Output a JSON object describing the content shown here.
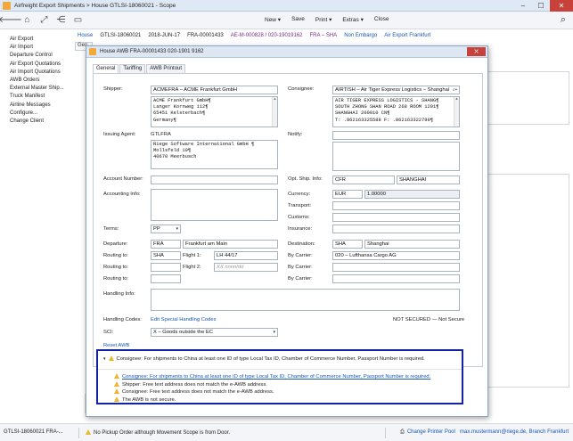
{
  "window": {
    "title": "Airfreight Export Shipments > House GTLSI-18060021 - Scope",
    "controls": {
      "minimize": "–",
      "maximize": "☐",
      "close": "✕"
    }
  },
  "toolbar": {
    "menu": {
      "new": "New ▾",
      "save": "Save",
      "print": "Print ▾",
      "extras": "Extras ▾",
      "close": "Close"
    },
    "icons": [
      "back-arrow-icon",
      "home-icon",
      "expand-icon",
      "share-icon",
      "inbox-icon",
      "search-icon"
    ]
  },
  "left_nav": {
    "items": [
      "Air Export",
      "Air Import",
      "Departure Control",
      "Air Export Quotations",
      "Air Import Quotations",
      "AWB Orders",
      "External Master Ship...",
      "Truck Manifest",
      "Airline Messages",
      "Configure...",
      "Change Client"
    ]
  },
  "main_header": {
    "house": "House",
    "ref1": "GTLSI-18060021",
    "date": "2018-JUN-17",
    "fra": "FRA-00001433",
    "awb": "AE-M-000828 / 020-19019162",
    "route": "FRA – SHA",
    "embargo": "Non Embargo",
    "station": "Air Export Frankfurt",
    "bg_tab": "Gen"
  },
  "dialog": {
    "title": "House AWB FRA-00001433 020-1901 9162",
    "close": "✕",
    "tabs": [
      "General",
      "Tariffing",
      "AWB Printout"
    ],
    "shipper": {
      "label": "Shipper:",
      "value": "ACMEFRA – ACME Frankfurt GmbH",
      "lines": [
        "ACME Frankfurt GmbH¶",
        "Langer Kornweg 112¶",
        "65451 Kelsterbach¶",
        "Germany¶"
      ]
    },
    "consignee": {
      "label": "Consignee:",
      "value": "AIRTISH – Air Tiger Express Logistics – Shanghai",
      "lines": [
        "AIR TIGER EXPRESS LOGISTICS - SHANG¶",
        "SOUTH ZHONG SHAN ROAD 268 ROOM 1201¶",
        "SHANGHAI 200010 CN¶",
        "T: .862163325588 F: .862163322799¶"
      ]
    },
    "issuing_agent": {
      "label": "Issuing Agent:",
      "value": "GTLFRA",
      "lines": [
        "Riege Software International GmbH ¶",
        "Mollsfeld 10¶",
        "40670 Meerbusch"
      ]
    },
    "notify": {
      "label": "Notify:"
    },
    "account_number": {
      "label": "Account Number:"
    },
    "opt_ship_info": {
      "label": "Opt. Ship. Info:",
      "code": "CFR",
      "city": "SHANGHAI"
    },
    "accounting_info": {
      "label": "Accounting Info:"
    },
    "currency": {
      "label": "Currency:",
      "code": "EUR",
      "rate": "1.00000"
    },
    "transport": {
      "label": "Transport:"
    },
    "customs": {
      "label": "Customs:"
    },
    "insurance": {
      "label": "Insurance:"
    },
    "terms": {
      "label": "Terms:",
      "value": "PP"
    },
    "departure": {
      "label": "Departure:",
      "code": "FRA",
      "name": "Frankfurt am Main"
    },
    "destination": {
      "label": "Destination:",
      "code": "SHA",
      "name": "Shanghai"
    },
    "routing1": {
      "label": "Routing to:",
      "value": "SHA",
      "flight_label": "Flight 1:",
      "flight": "LH 44/17"
    },
    "by_carrier1": {
      "label": "By Carrier:",
      "value": "020 – Lufthansa Cargo AG"
    },
    "routing2": {
      "label": "Routing to:",
      "flight_label": "Flight 2:",
      "flight_placeholder": "XX nnnn/dd"
    },
    "by_carrier2": {
      "label": "By Carrier:"
    },
    "routing3": {
      "label": "Routing to:"
    },
    "by_carrier3": {
      "label": "By Carrier:"
    },
    "handling_info": {
      "label": "Handling Info:"
    },
    "handling_codes": {
      "label": "Handling Codes:",
      "link": "Edit Special Handling Codes"
    },
    "security": "NOT SECURED — Not Secure",
    "sci": {
      "label": "SCI:",
      "value": "X – Goods outside the EC"
    },
    "reset": "Reset AWB"
  },
  "warnings": {
    "header": "Consignee: For shipments to China at least one ID of type Local Tax ID, Chamber of Commerce Number, Passport Number is required.",
    "items": [
      "Consignee: For shipments to China at least one ID of type Local Tax ID, Chamber of Commerce Number, Passport Number is required.",
      "Shipper: Free text address does not match the e-AWB address.",
      "Consignee: Free text address does not match the e-AWB address.",
      "The AWB is not secure."
    ]
  },
  "statusbar": {
    "id": "GTLSI-18060021 FRA-...",
    "warning": "No Pickup Order although Movement Scope is from Door.",
    "printer": "Change Printer Pool",
    "user": "max.mustermann@riege.de, Branch Frankfurt"
  },
  "colors": {
    "accent": "#1a56b8",
    "warning": "#f0b52a",
    "highlight_border": "#1122a6",
    "close_red": "#c8413b"
  }
}
